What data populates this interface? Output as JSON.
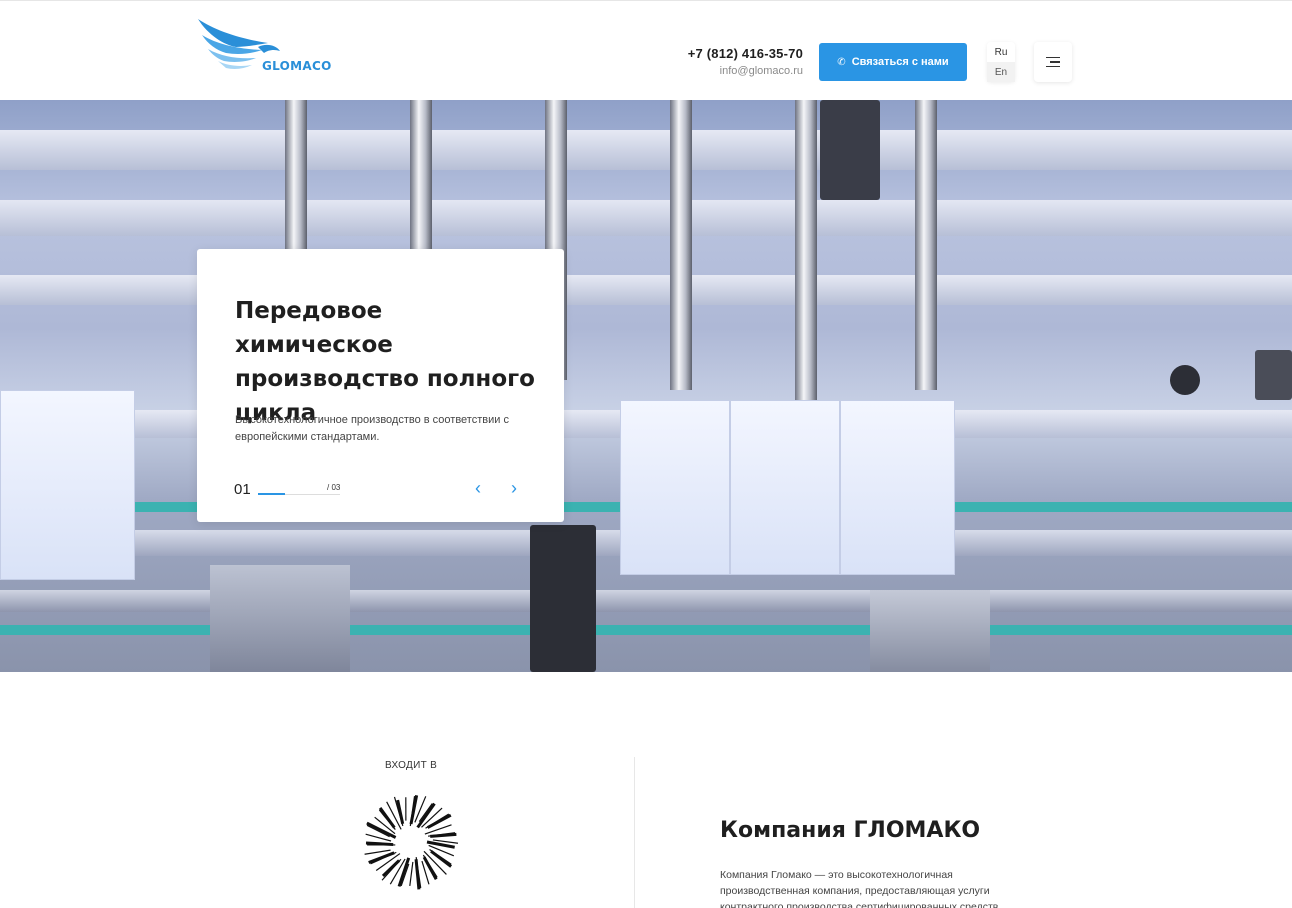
{
  "header": {
    "logo_text": "GLOMACO",
    "phone": "+7 (812) 416-35-70",
    "email": "info@glomaco.ru",
    "cta_label": "Связаться с нами",
    "cta_icon": "phone-icon",
    "languages": [
      "Ru",
      "En"
    ],
    "active_language": "Ru",
    "menu_icon": "hamburger-icon"
  },
  "hero": {
    "title": "Передовое химическое производство полного цикла",
    "subtitle": "Высокотехнологичное производство в соответствии с европейскими стандартами.",
    "current_slide": "01",
    "total_slides": "/ 03",
    "progress": 0.33,
    "prev_icon": "chevron-left-icon",
    "next_icon": "chevron-right-icon"
  },
  "about": {
    "part_of_label": "ВХОДИТ В",
    "title": "Компания ГЛОМАКО",
    "text": "Компания Гломако — это высокотехнологичная производственная компания, предоставляющая услуги контрактного производства сертифицированных средств"
  },
  "colors": {
    "accent": "#2a95e4",
    "text": "#1f1f1f",
    "teal": "#3bb2b1"
  }
}
